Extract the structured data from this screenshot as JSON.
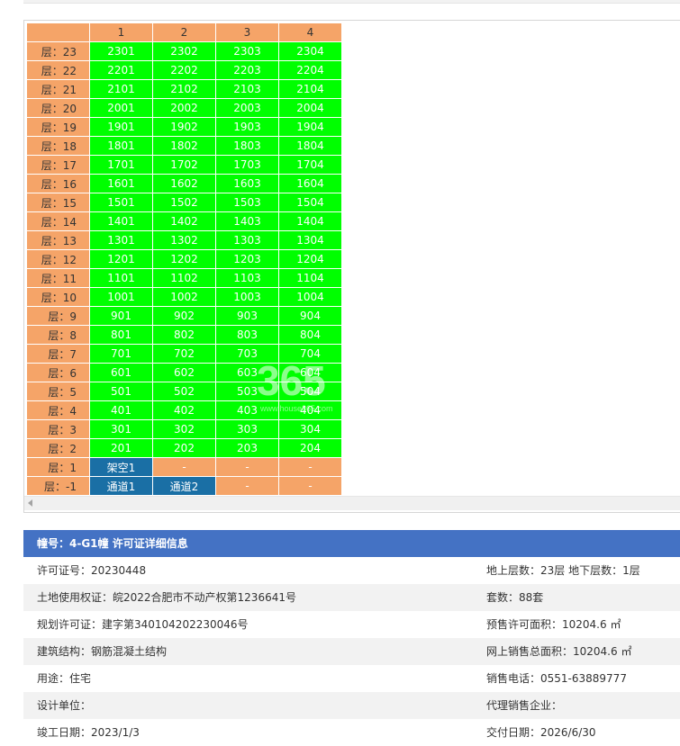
{
  "table": {
    "columns": [
      "1",
      "2",
      "3",
      "4"
    ],
    "rows": [
      {
        "floor": "层：23",
        "units": [
          "2301",
          "2302",
          "2303",
          "2304"
        ]
      },
      {
        "floor": "层：22",
        "units": [
          "2201",
          "2202",
          "2203",
          "2204"
        ]
      },
      {
        "floor": "层：21",
        "units": [
          "2101",
          "2102",
          "2103",
          "2104"
        ]
      },
      {
        "floor": "层：20",
        "units": [
          "2001",
          "2002",
          "2003",
          "2004"
        ]
      },
      {
        "floor": "层：19",
        "units": [
          "1901",
          "1902",
          "1903",
          "1904"
        ]
      },
      {
        "floor": "层：18",
        "units": [
          "1801",
          "1802",
          "1803",
          "1804"
        ]
      },
      {
        "floor": "层：17",
        "units": [
          "1701",
          "1702",
          "1703",
          "1704"
        ]
      },
      {
        "floor": "层：16",
        "units": [
          "1601",
          "1602",
          "1603",
          "1604"
        ]
      },
      {
        "floor": "层：15",
        "units": [
          "1501",
          "1502",
          "1503",
          "1504"
        ]
      },
      {
        "floor": "层：14",
        "units": [
          "1401",
          "1402",
          "1403",
          "1404"
        ]
      },
      {
        "floor": "层：13",
        "units": [
          "1301",
          "1302",
          "1303",
          "1304"
        ]
      },
      {
        "floor": "层：12",
        "units": [
          "1201",
          "1202",
          "1203",
          "1204"
        ]
      },
      {
        "floor": "层：11",
        "units": [
          "1101",
          "1102",
          "1103",
          "1104"
        ]
      },
      {
        "floor": "层：10",
        "units": [
          "1001",
          "1002",
          "1003",
          "1004"
        ]
      },
      {
        "floor": "层：9",
        "units": [
          "901",
          "902",
          "903",
          "904"
        ]
      },
      {
        "floor": "层：8",
        "units": [
          "801",
          "802",
          "803",
          "804"
        ]
      },
      {
        "floor": "层：7",
        "units": [
          "701",
          "702",
          "703",
          "704"
        ]
      },
      {
        "floor": "层：6",
        "units": [
          "601",
          "602",
          "603",
          "604"
        ]
      },
      {
        "floor": "层：5",
        "units": [
          "501",
          "502",
          "503",
          "504"
        ]
      },
      {
        "floor": "层：4",
        "units": [
          "401",
          "402",
          "403",
          "404"
        ]
      },
      {
        "floor": "层：3",
        "units": [
          "301",
          "302",
          "303",
          "304"
        ]
      },
      {
        "floor": "层：2",
        "units": [
          "201",
          "202",
          "203",
          "204"
        ]
      },
      {
        "floor": "层：1",
        "units": [
          "架空1",
          "-",
          "-",
          "-"
        ]
      },
      {
        "floor": "层：-1",
        "units": [
          "通道1",
          "通道2",
          "-",
          "-"
        ]
      }
    ],
    "status_colors": {
      "available": "#00ff00",
      "special": "#1a6fa5",
      "empty": "#f5a468",
      "header": "#f5a468"
    }
  },
  "watermark": {
    "number": "365",
    "url": "www.house365.com"
  },
  "info": {
    "header": "幢号：4-G1幢 许可证详细信息",
    "header_color": "#4472c4",
    "rows": [
      {
        "left": "许可证号：20230448",
        "right": "地上层数：23层  地下层数：1层"
      },
      {
        "left": "土地使用权证：皖2022合肥市不动产权第1236641号",
        "right": "套数：88套"
      },
      {
        "left": "规划许可证：建字第340104202230046号",
        "right": "预售许可面积：10204.6 ㎡"
      },
      {
        "left": "建筑结构：钢筋混凝土结构",
        "right": "网上销售总面积：10204.6 ㎡"
      },
      {
        "left": "用途：住宅",
        "right": "销售电话：0551-63889777"
      },
      {
        "left": "设计单位：",
        "right": "代理销售企业："
      },
      {
        "left": "竣工日期：2023/1/3",
        "right": "交付日期：2026/6/30"
      }
    ]
  }
}
